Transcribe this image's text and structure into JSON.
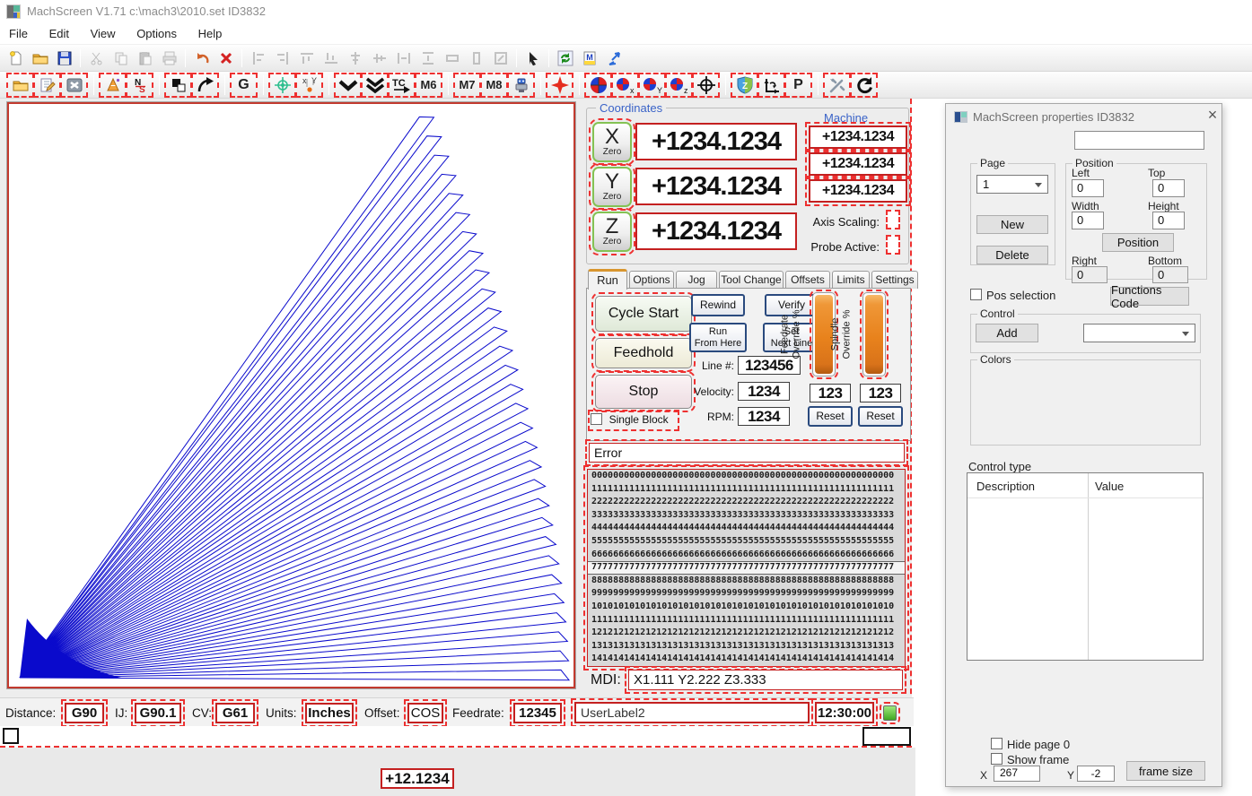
{
  "window": {
    "title": "MachScreen V1.71   c:\\mach3\\2010.set   ID3832"
  },
  "menu": {
    "items": [
      "File",
      "Edit",
      "View",
      "Options",
      "Help"
    ]
  },
  "toolbars": {
    "main": [
      {
        "name": "new-file",
        "icon": "doc"
      },
      {
        "name": "open-file",
        "icon": "folder"
      },
      {
        "name": "save-file",
        "icon": "floppy"
      },
      {
        "sep": true
      },
      {
        "name": "cut",
        "icon": "scissors",
        "disabled": true
      },
      {
        "name": "copy",
        "icon": "copy",
        "disabled": true
      },
      {
        "name": "paste",
        "icon": "paste",
        "disabled": true
      },
      {
        "name": "print",
        "icon": "print",
        "disabled": true
      },
      {
        "sep": true
      },
      {
        "name": "undo",
        "icon": "undo"
      },
      {
        "name": "delete",
        "icon": "xred"
      },
      {
        "sep": true
      },
      {
        "name": "align-left",
        "icon": "al",
        "disabled": true
      },
      {
        "name": "align-right",
        "icon": "ar",
        "disabled": true
      },
      {
        "name": "align-top",
        "icon": "at",
        "disabled": true
      },
      {
        "name": "align-bottom",
        "icon": "ab",
        "disabled": true
      },
      {
        "name": "center-horizontal",
        "icon": "ch",
        "disabled": true
      },
      {
        "name": "center-vertical",
        "icon": "cv2",
        "disabled": true
      },
      {
        "name": "space-across",
        "icon": "sa",
        "disabled": true
      },
      {
        "name": "space-down",
        "icon": "sd",
        "disabled": true
      },
      {
        "name": "same-width",
        "icon": "sw",
        "disabled": true
      },
      {
        "name": "same-height",
        "icon": "sh",
        "disabled": true
      },
      {
        "name": "same-size",
        "icon": "ss",
        "disabled": true
      },
      {
        "sep": true
      },
      {
        "name": "select-pointer",
        "icon": "pointer"
      },
      {
        "sep": true
      },
      {
        "name": "refresh-screen",
        "icon": "refreshbox"
      },
      {
        "name": "screen-set",
        "icon": "mdoc"
      },
      {
        "name": "import-elements",
        "icon": "scatter"
      }
    ],
    "screen": [
      {
        "name": "load-gcode",
        "icon": "folder"
      },
      {
        "name": "edit-gcode",
        "icon": "editdoc"
      },
      {
        "name": "close-gcode",
        "icon": "closex"
      },
      {
        "sep": true
      },
      {
        "name": "wizards",
        "icon": "cone"
      },
      {
        "name": "ns-toggle",
        "icon": "ns"
      },
      {
        "sep": true
      },
      {
        "name": "display-mode",
        "icon": "bw"
      },
      {
        "name": "regen-toolpath",
        "icon": "curve"
      },
      {
        "sep": true
      },
      {
        "name": "gcode-g",
        "icon": "g"
      },
      {
        "sep": true
      },
      {
        "name": "probe",
        "icon": "target"
      },
      {
        "name": "jog-xy",
        "icon": "xydot"
      },
      {
        "sep": true
      },
      {
        "name": "goto-z",
        "icon": "chev1"
      },
      {
        "name": "goto-zs",
        "icon": "chev2"
      },
      {
        "name": "tool-change",
        "icon": "tc"
      },
      {
        "name": "m6-macro",
        "icon": "m6"
      },
      {
        "sep": true
      },
      {
        "name": "m7-mist",
        "icon": "m7"
      },
      {
        "name": "m8-flood",
        "icon": "m8"
      },
      {
        "name": "spindle-machine",
        "icon": "robot"
      },
      {
        "sep": true
      },
      {
        "name": "ref-all-home",
        "icon": "redplus"
      },
      {
        "sep": true
      },
      {
        "name": "dro-all",
        "icon": "droc"
      },
      {
        "name": "dro-x",
        "icon": "drox"
      },
      {
        "name": "dro-y",
        "icon": "droy"
      },
      {
        "name": "dro-z",
        "icon": "droz"
      },
      {
        "name": "machine-coords",
        "icon": "crosshair"
      },
      {
        "sep": true
      },
      {
        "name": "safe-z",
        "icon": "shield"
      },
      {
        "name": "set-origin",
        "icon": "axisarrow"
      },
      {
        "name": "park",
        "icon": "p"
      },
      {
        "sep": true
      },
      {
        "name": "config-tools",
        "icon": "tools"
      },
      {
        "name": "regen",
        "icon": "refreshc"
      }
    ],
    "icon_text": {
      "g": "G",
      "m6": "M6",
      "m7": "M7",
      "m8": "M8",
      "p": "P"
    }
  },
  "coordinates": {
    "label": "Coordinates",
    "machine_label": "Machine",
    "axes": [
      {
        "letter": "X",
        "zero": "Zero",
        "value": "+1234.1234"
      },
      {
        "letter": "Y",
        "zero": "Zero",
        "value": "+1234.1234"
      },
      {
        "letter": "Z",
        "zero": "Zero",
        "value": "+1234.1234"
      }
    ],
    "machine_values": [
      "+1234.1234",
      "+1234.1234",
      "+1234.1234"
    ],
    "axis_scaling_label": "Axis Scaling:",
    "probe_active_label": "Probe Active:"
  },
  "tabs": [
    {
      "label": "Run"
    },
    {
      "label": "Options"
    },
    {
      "label": "Jog"
    },
    {
      "label": "Tool Change"
    },
    {
      "label": "Offsets"
    },
    {
      "label": "Limits"
    },
    {
      "label": "Settings"
    }
  ],
  "run": {
    "cycle_start": "Cycle Start",
    "feedhold": "Feedhold",
    "stop": "Stop",
    "single_block": "Single Block",
    "rewind": "Rewind",
    "verify": "Verify",
    "run_from_here": [
      "Run",
      "From Here"
    ],
    "set_next_line": [
      "Set",
      "Next Line"
    ],
    "line_label": "Line #:",
    "line_value": "123456",
    "velocity_label": "Velocity:",
    "velocity_value": "1234",
    "rpm_label": "RPM:",
    "rpm_value": "1234",
    "feed_override_label": [
      "Feedrate",
      "Override %"
    ],
    "spindle_override_label": [
      "Spindle",
      "Override %"
    ],
    "feed_override_value": "123",
    "spindle_override_value": "123",
    "feed_reset": "Reset",
    "spindle_reset": "Reset"
  },
  "error_text": "Error",
  "gcode": {
    "selected_index": 7,
    "lines": [
      "00000000000000000000000000000000000000000000000000000000",
      "11111111111111111111111111111111111111111111111111111111",
      "22222222222222222222222222222222222222222222222222222222",
      "33333333333333333333333333333333333333333333333333333333",
      "44444444444444444444444444444444444444444444444444444444",
      "55555555555555555555555555555555555555555555555555555555",
      "66666666666666666666666666666666666666666666666666666666",
      "77777777777777777777777777777777777777777777777777777777",
      "88888888888888888888888888888888888888888888888888888888",
      "99999999999999999999999999999999999999999999999999999999",
      "10101010101010101010101010101010101010101010101010101010",
      "11111111111111111111111111111111111111111111111111111111",
      "12121212121212121212121212121212121212121212121212121212",
      "13131313131313131313131313131313131313131313131313131313",
      "14141414141414141414141414141414141414141414141414141414"
    ]
  },
  "mdi": {
    "label": "MDI:",
    "value": "X1.111 Y2.222 Z3.333"
  },
  "statusbar": {
    "distance_label": "Distance:",
    "distance_value": "G90",
    "ij_label": "IJ:",
    "ij_value": "G90.1",
    "cv_label": "CV:",
    "cv_value": "G61",
    "units_label": "Units:",
    "units_value": "Inches",
    "offset_label": "Offset:",
    "offset_value": "COS",
    "feedrate_label": "Feedrate:",
    "feedrate_value": "12345",
    "user_label": "UserLabel2",
    "time": "12:30:00"
  },
  "bottom_dro": "+12.1234",
  "plot": {
    "petals": 30,
    "origin": [
      12,
      640
    ],
    "tip_x_max": 624,
    "tip_x_span": 156,
    "tip_y_min": 11,
    "tip_y_span": 626,
    "color": "#0a0acc"
  },
  "dialog": {
    "title": "MachScreen properties  ID3832",
    "close": "×",
    "page": {
      "label": "Page",
      "selected": "1",
      "new_btn": "New",
      "delete_btn": "Delete"
    },
    "position": {
      "label": "Position",
      "left_label": "Left",
      "left_value": "0",
      "top_label": "Top",
      "top_value": "0",
      "width_label": "Width",
      "width_value": "0",
      "height_label": "Height",
      "height_value": "0",
      "position_btn": "Position",
      "right_label": "Right",
      "right_value": "0",
      "bottom_label": "Bottom",
      "bottom_value": "0"
    },
    "pos_selection_label": "Pos selection",
    "functions_code_btn": "Functions Code",
    "control": {
      "label": "Control",
      "add_btn": "Add"
    },
    "colors_label": "Colors",
    "control_type_label": "Control type",
    "table": {
      "columns": [
        "Description",
        "Value"
      ]
    },
    "hide_page_label": "Hide page 0",
    "show_frame_label": "Show frame",
    "x_label": "X",
    "x_value": "267",
    "y_label": "Y",
    "y_value": "-2",
    "frame_size_btn": "frame size"
  }
}
